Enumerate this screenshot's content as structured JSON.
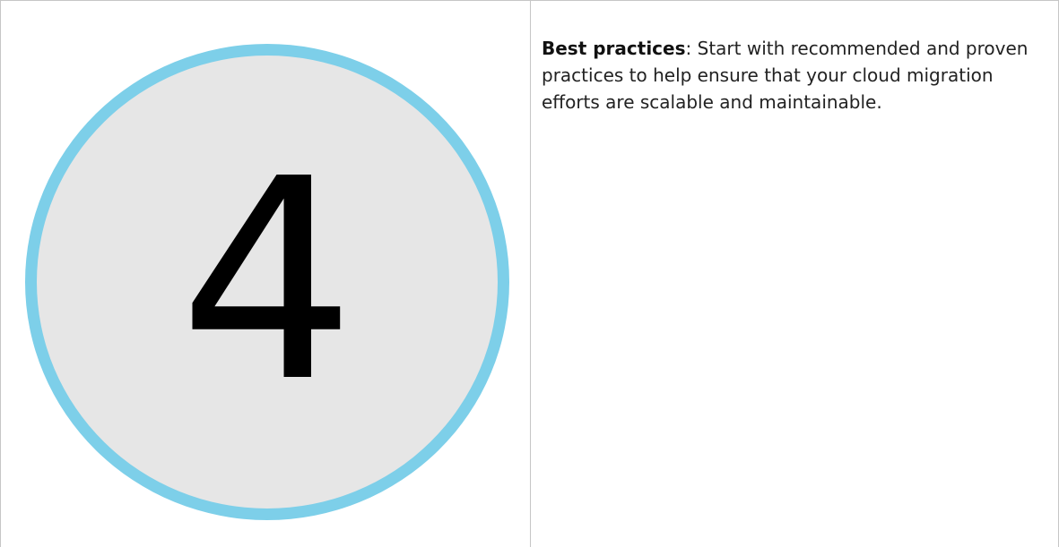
{
  "step": {
    "number": "4"
  },
  "description": {
    "term": "Best practices",
    "separator": ":",
    "text": " Start with recommended and proven practices to help ensure that your cloud migration efforts are scalable and maintainable."
  },
  "colors": {
    "circle_border": "#7dcfe9",
    "circle_fill": "#e6e6e6",
    "table_border": "#c6c6c6"
  }
}
